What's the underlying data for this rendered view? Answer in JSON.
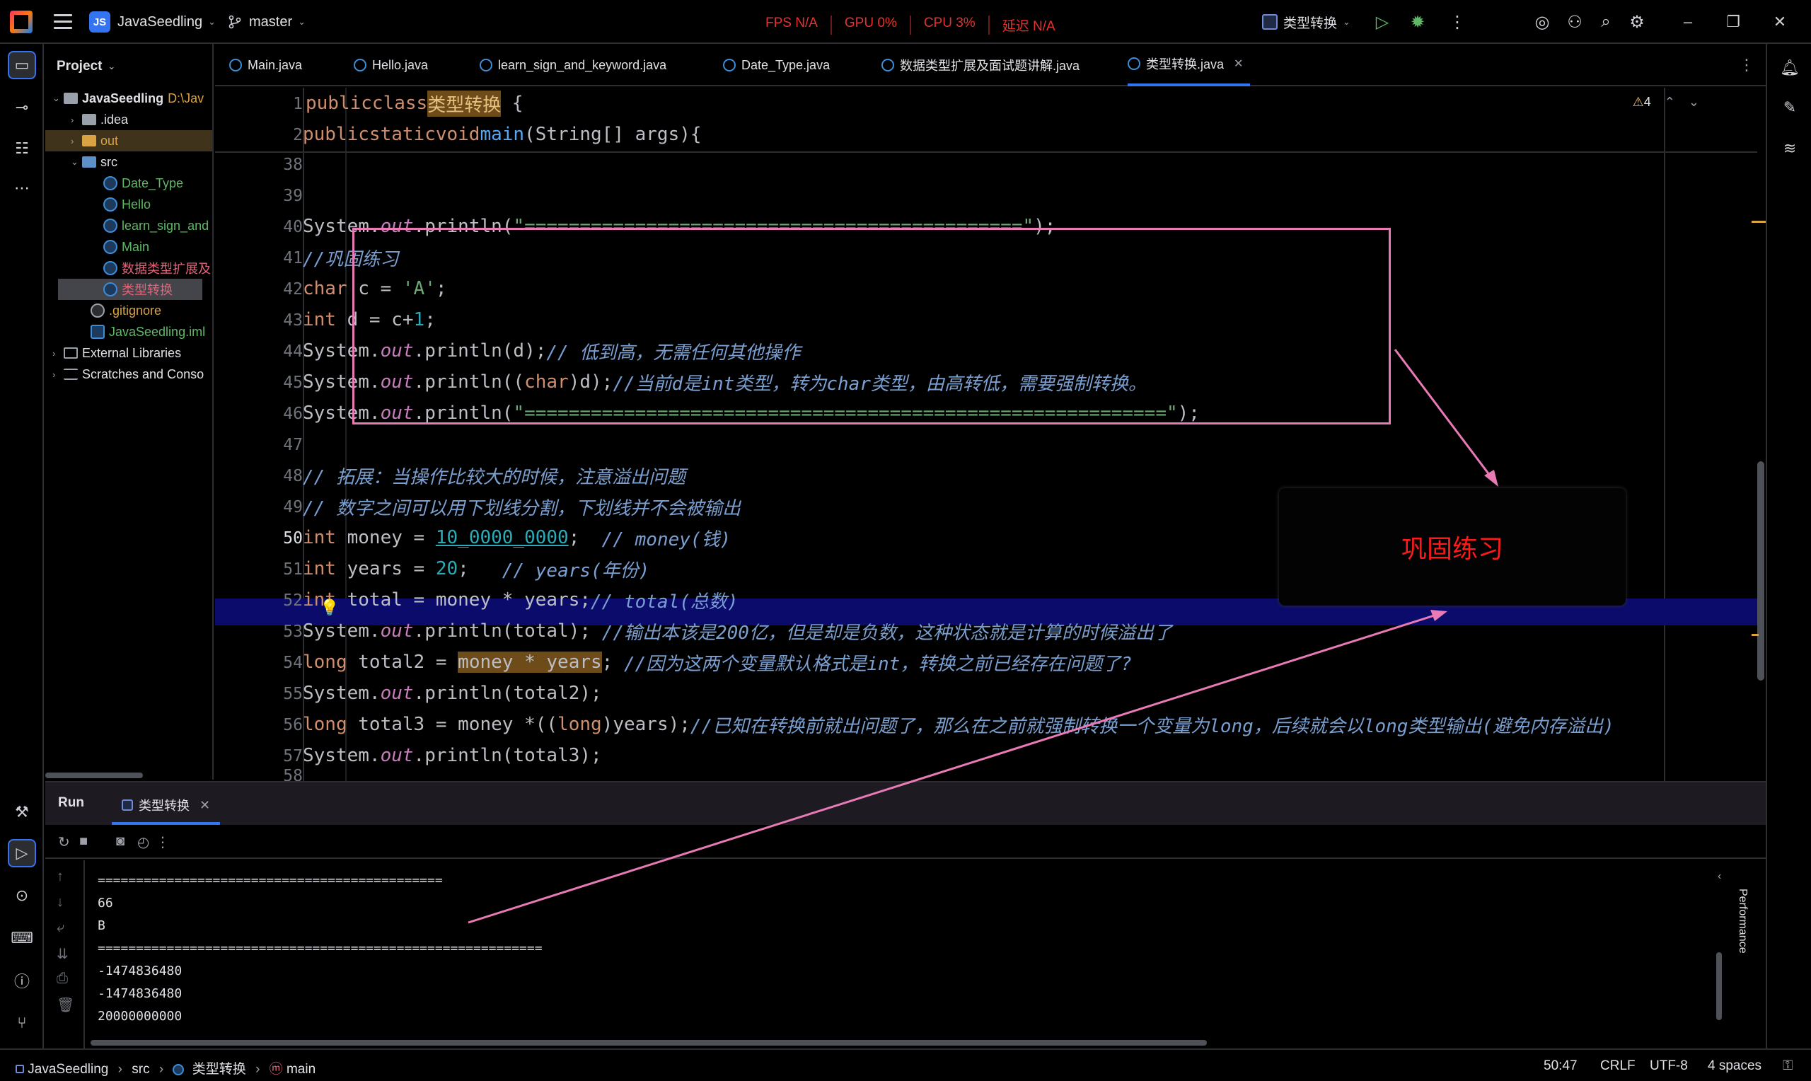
{
  "titlebar": {
    "project": "JavaSeedling",
    "project_badge": "JS",
    "branch": "master",
    "perf": [
      "FPS N/A",
      "GPU 0%",
      "CPU 3%",
      "延迟 N/A"
    ],
    "run_config": "类型转换"
  },
  "project_pane": {
    "title": "Project",
    "tree": [
      {
        "label": "JavaSeedling",
        "suffix": "D:\\Jav"
      },
      {
        "label": ".idea"
      },
      {
        "label": "out"
      },
      {
        "label": "src"
      },
      {
        "label": "Date_Type"
      },
      {
        "label": "Hello"
      },
      {
        "label": "learn_sign_and"
      },
      {
        "label": "Main"
      },
      {
        "label": "数据类型扩展及"
      },
      {
        "label": "类型转换"
      },
      {
        "label": ".gitignore"
      },
      {
        "label": "JavaSeedling.iml"
      },
      {
        "label": "External Libraries"
      },
      {
        "label": "Scratches and Conso"
      }
    ]
  },
  "tabs": [
    "Main.java",
    "Hello.java",
    "learn_sign_and_keyword.java",
    "Date_Type.java",
    "数据类型扩展及面试题讲解.java",
    "类型转换.java"
  ],
  "editor": {
    "warnings": "4",
    "sticky": [
      {
        "num": "1"
      },
      {
        "num": "2"
      }
    ],
    "lines": [
      {
        "num": "38"
      },
      {
        "num": "39"
      },
      {
        "num": "40"
      },
      {
        "num": "41"
      },
      {
        "num": "42"
      },
      {
        "num": "43"
      },
      {
        "num": "44"
      },
      {
        "num": "45"
      },
      {
        "num": "46"
      },
      {
        "num": "47"
      },
      {
        "num": "48"
      },
      {
        "num": "49"
      },
      {
        "num": "50"
      },
      {
        "num": "51"
      },
      {
        "num": "52"
      },
      {
        "num": "53"
      },
      {
        "num": "54"
      },
      {
        "num": "55"
      },
      {
        "num": "56"
      },
      {
        "num": "57"
      },
      {
        "num": "58"
      }
    ],
    "text": {
      "public": "public",
      "class": "class",
      "class_name": "类型转换",
      "static": "static",
      "void": "void",
      "main": "main",
      "main_sig": "(String[] args){",
      "l40_str": "\"=============================================\"",
      "l41_cmt": "//巩固练习",
      "l42_c": " c = ",
      "l42_str": "'A'",
      "l43_d": " d = c+",
      "l43_num": "1",
      "l44_cmt": "// 低到高，无需任何其他操作",
      "l45_cmt": "//当前d是int类型，转为char类型，由高转低，需要强制转换。",
      "l46_str": "\"==========================================================\"",
      "l48_cmt": "// 拓展：当操作比较大的时候，注意溢出问题",
      "l49_cmt": "// 数字之间可以用下划线分割，下划线并不会被输出",
      "l50_var": " money = ",
      "l50_num": "10_0000_0000",
      "l50_cmt": "// money(钱)",
      "l51_var": " years = ",
      "l51_num": "20",
      "l51_cmt": "// years(年份)",
      "l52_var": " total = money * years;",
      "l52_cmt": "// total(总数)",
      "l53_cmt": "//输出本该是200亿，但是却是负数，这种状态就是计算的时候溢出了",
      "l54_var": " total2 = ",
      "l54_expr": "money * years",
      "l54_cmt": "//因为这两个变量默认格式是int，转换之前已经存在问题了?",
      "l56_var": " total3 = money *((",
      "l56_long": "long",
      "l56_rest": ")years);",
      "l56_cmt": "//已知在转换前就出问题了，那么在之前就强制转换一个变量为long，后续就会以long类型输出(避免内存溢出)",
      "system": "System.",
      "out": "out",
      "println": ".println(",
      "int": "int",
      "char": "char",
      "long": "long",
      "println_d": ".println(d);",
      "println_char": ".println((",
      "char_d": ")d);",
      "total": "total",
      "total2": "total2",
      "total3": "total3"
    },
    "callout": "巩固练习"
  },
  "run": {
    "title": "Run",
    "tab": "类型转换",
    "console": [
      "=============================================",
      "66",
      "B",
      "==========================================================",
      "-1474836480",
      "-1474836480",
      "20000000000"
    ],
    "side_label": "Performance"
  },
  "status": {
    "crumbs": [
      "JavaSeedling",
      "src",
      "类型转换",
      "main"
    ],
    "position": "50:47",
    "line_sep": "CRLF",
    "encoding": "UTF-8",
    "indent": "4 spaces"
  }
}
